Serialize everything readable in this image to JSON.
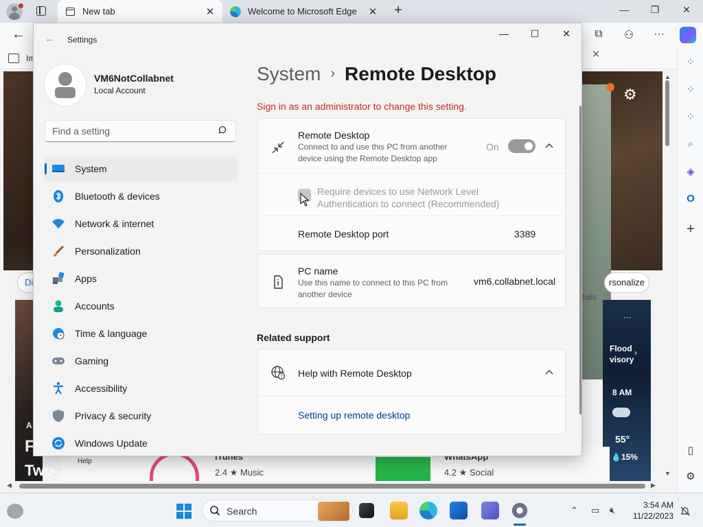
{
  "browser": {
    "tabs": [
      {
        "label": "New tab",
        "active": true
      },
      {
        "label": "Welcome to Microsoft Edge",
        "active": false
      }
    ],
    "favorites_bar_item": "Im",
    "page": {
      "pill_left": "Di",
      "pill_right": "rsonalize",
      "details": "tails",
      "left_card_big": "F",
      "left_card_sub": "Two-",
      "left_card_tag": "A",
      "weather_alert": "Flood\nvisory",
      "weather_time": "8 AM",
      "weather_temp": "55°",
      "weather_precip": "💧15%",
      "help": "Help",
      "app1_title": "iTunes",
      "app1_meta": "2.4 ★  Music",
      "app2_title": "WhatsApp",
      "app2_meta": "4.2 ★  Social"
    }
  },
  "settings": {
    "window_title": "Settings",
    "user": {
      "name": "VM6NotCollabnet",
      "account_type": "Local Account"
    },
    "search": {
      "placeholder": "Find a setting"
    },
    "nav": [
      {
        "label": "System",
        "icon": "monitor-icon",
        "selected": true
      },
      {
        "label": "Bluetooth & devices",
        "icon": "bluetooth-icon"
      },
      {
        "label": "Network & internet",
        "icon": "wifi-icon"
      },
      {
        "label": "Personalization",
        "icon": "brush-icon"
      },
      {
        "label": "Apps",
        "icon": "apps-icon"
      },
      {
        "label": "Accounts",
        "icon": "person-icon"
      },
      {
        "label": "Time & language",
        "icon": "globe-clock-icon"
      },
      {
        "label": "Gaming",
        "icon": "gamepad-icon"
      },
      {
        "label": "Accessibility",
        "icon": "accessibility-icon"
      },
      {
        "label": "Privacy & security",
        "icon": "shield-icon"
      },
      {
        "label": "Windows Update",
        "icon": "update-icon"
      }
    ],
    "breadcrumb": {
      "parent": "System",
      "separator": "›",
      "current": "Remote Desktop"
    },
    "warning": "Sign in as an administrator to change this setting.",
    "remote_desktop": {
      "title": "Remote Desktop",
      "description": "Connect to and use this PC from another device using the Remote Desktop app",
      "toggle_label": "On",
      "toggle_on": true,
      "nla_label": "Require devices to use Network Level Authentication to connect (Recommended)",
      "port_label": "Remote Desktop port",
      "port_value": "3389"
    },
    "pc_name": {
      "title": "PC name",
      "description": "Use this name to connect to this PC from another device",
      "value": "vm6.collabnet.local"
    },
    "related_support": {
      "heading": "Related support",
      "help_title": "Help with Remote Desktop",
      "link": "Setting up remote desktop"
    }
  },
  "taskbar": {
    "search_label": "Search",
    "time": "3:54 AM",
    "date": "11/22/2023"
  },
  "colors": {
    "accent": "#0067c0",
    "warning": "#c42b1c",
    "link": "#003e92"
  }
}
